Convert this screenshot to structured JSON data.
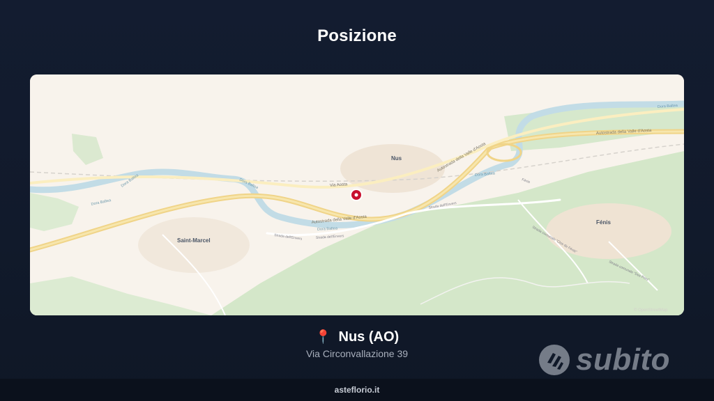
{
  "header": {
    "title": "Posizione"
  },
  "map": {
    "places": {
      "nus": "Nus",
      "saint_marcel": "Saint-Marcel",
      "fenis": "Fénis"
    },
    "roads": {
      "autostrada_1": "Autostrada della Valle d'Aosta",
      "autostrada_2": "Autostrada della Valle d'Aosta",
      "autostrada_3": "Autostrada della Valle d'Aosta",
      "via_aosta": "Via Aosta",
      "strada_envers_1": "Strada dell'Envers",
      "strada_envers_2": "Strada dell'Envers",
      "strada_envers_3": "Strada dell'Envers",
      "fenis_road": "Fénis",
      "comunale_1": "Strada comunale \"Clos de Fénis\"",
      "comunale_2": "Strada comunale \"Des Pres\""
    },
    "rivers": {
      "dora_1": "Dora Baltea",
      "dora_2": "Dora Baltea",
      "dora_3": "Dora Baltea",
      "dora_4": "Dora Baltea",
      "dora_5": "Dora Baltea",
      "dora_6": "Dora Baltea"
    },
    "attribution": "© OpenStreetMap",
    "colors": {
      "land": "#f8f3ec",
      "forest": "#d6e8cc",
      "water": "#c2dce6",
      "motorway": "#f2d98a",
      "marker": "#c8102e"
    }
  },
  "location": {
    "pin_icon": "📍",
    "city": "Nus (AO)",
    "address": "Via Circonvallazione 39"
  },
  "brand": {
    "name": "subito",
    "icon": "subito-logo-icon"
  },
  "footer": {
    "site": "asteflorio.it"
  }
}
